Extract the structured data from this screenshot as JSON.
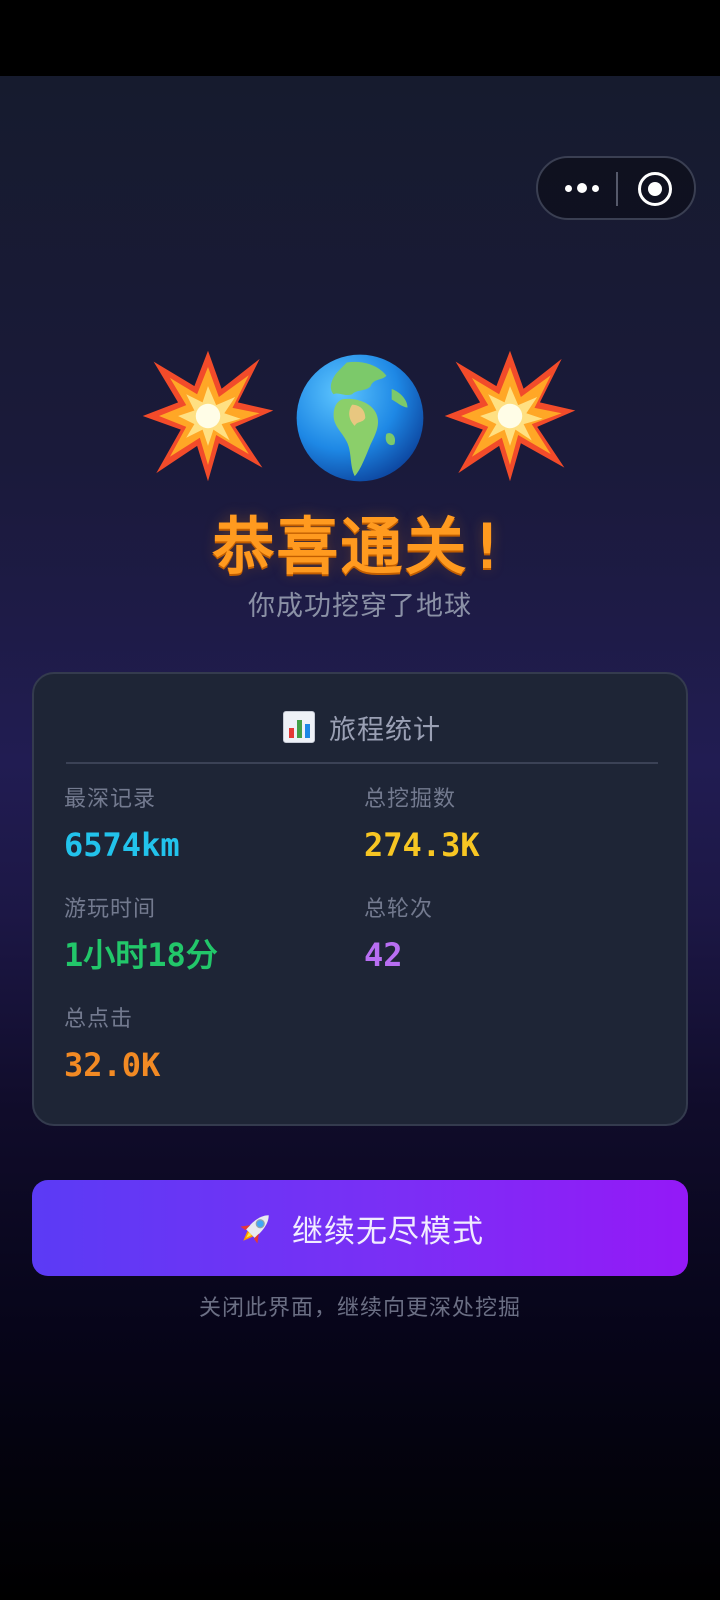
{
  "capsule": {
    "more_icon": "more-dots-icon",
    "close_icon": "target-circle-icon"
  },
  "hero": {
    "icons": [
      "collision-icon",
      "earth-globe-icon",
      "collision-icon"
    ],
    "title": "恭喜通关!",
    "subtitle": "你成功挖穿了地球"
  },
  "stats": {
    "header_icon": "bar-chart-icon",
    "title": "旅程统计",
    "items": [
      {
        "label": "最深记录",
        "value": "6574km",
        "color": "#22c3ec"
      },
      {
        "label": "总挖掘数",
        "value": "274.3K",
        "color": "#f7c623"
      },
      {
        "label": "游玩时间",
        "value": "1小时18分",
        "color": "#22c76a"
      },
      {
        "label": "总轮次",
        "value": "42",
        "color": "#b86ef2"
      },
      {
        "label": "总点击",
        "value": "32.0K",
        "color": "#f28a24"
      }
    ]
  },
  "cta": {
    "icon": "rocket-icon",
    "label": "继续无尽模式"
  },
  "hint": "关闭此界面，继续向更深处挖掘",
  "colors": {
    "title": "#ff9a1f",
    "cta_start": "#5b3bf5",
    "cta_end": "#9419f7"
  }
}
